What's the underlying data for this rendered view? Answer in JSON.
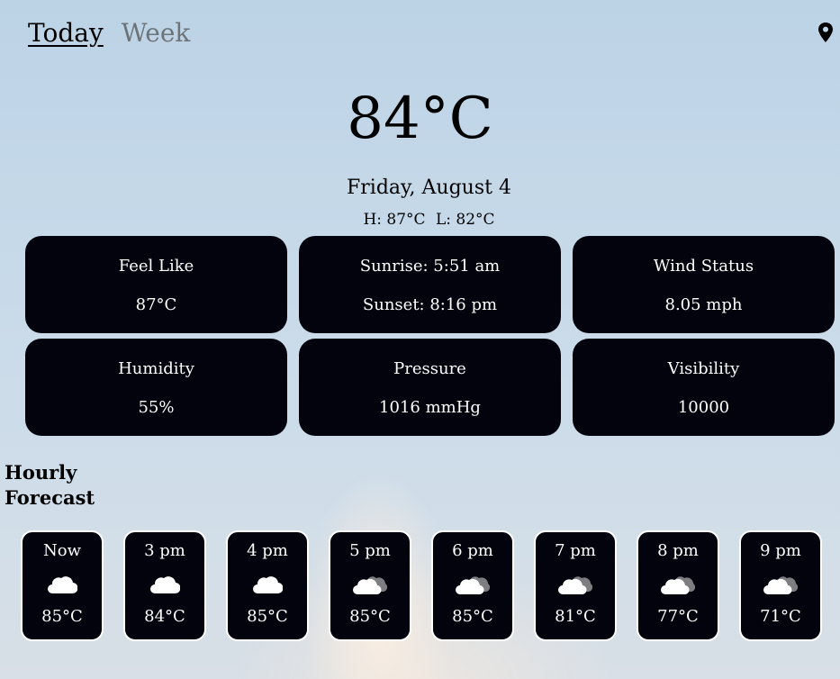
{
  "nav": {
    "tabs": [
      {
        "label": "Today",
        "active": true
      },
      {
        "label": "Week",
        "active": false
      }
    ],
    "location_icon": "map-pin-icon"
  },
  "current": {
    "temperature": "84°C",
    "date": "Friday, August 4",
    "high": "H: 87°C",
    "low": "L: 82°C"
  },
  "details": [
    {
      "line1": "Feel Like",
      "line2": "87°C"
    },
    {
      "line1": "Sunrise: 5:51 am",
      "line2": "Sunset: 8:16 pm"
    },
    {
      "line1": "Wind Status",
      "line2": "8.05 mph"
    },
    {
      "line1": "Humidity",
      "line2": "55%"
    },
    {
      "line1": "Pressure",
      "line2": "1016 mmHg"
    },
    {
      "line1": "Visibility",
      "line2": "10000"
    }
  ],
  "hourly": {
    "title_line1": "Hourly",
    "title_line2": "Forecast",
    "items": [
      {
        "time": "Now",
        "icon": "cloud-icon",
        "temp": "85°C"
      },
      {
        "time": "3 pm",
        "icon": "cloud-icon",
        "temp": "84°C"
      },
      {
        "time": "4 pm",
        "icon": "cloud-icon",
        "temp": "85°C"
      },
      {
        "time": "5 pm",
        "icon": "overcast-clouds-icon",
        "temp": "85°C"
      },
      {
        "time": "6 pm",
        "icon": "overcast-clouds-icon",
        "temp": "85°C"
      },
      {
        "time": "7 pm",
        "icon": "overcast-clouds-icon",
        "temp": "81°C"
      },
      {
        "time": "8 pm",
        "icon": "overcast-clouds-icon",
        "temp": "77°C"
      },
      {
        "time": "9 pm",
        "icon": "overcast-clouds-icon",
        "temp": "71°C"
      }
    ]
  },
  "colors": {
    "card_bg": "#03030d",
    "card_text": "#ffffff",
    "inactive_tab": "#6d7479"
  }
}
